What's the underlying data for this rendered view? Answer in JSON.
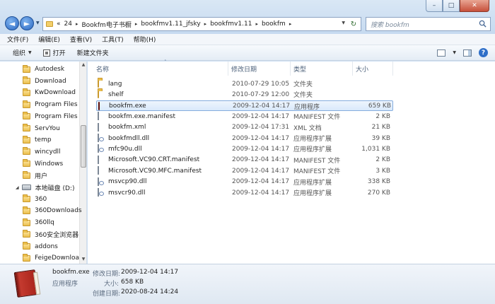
{
  "window": {
    "controls": {
      "minimize": "–",
      "maximize": "□",
      "close": "✕"
    }
  },
  "nav": {
    "back": "◄",
    "forward": "►",
    "dropdown": "▼"
  },
  "address": {
    "overflow": "«",
    "crumbs": [
      "24",
      "Bookfm电子书橱",
      "bookfmv1.11_jfsky",
      "bookfmv1.11",
      "bookfm"
    ],
    "sep": "▸",
    "refresh": "↻"
  },
  "search": {
    "placeholder": "搜索 bookfm"
  },
  "menu": [
    "文件(F)",
    "编辑(E)",
    "查看(V)",
    "工具(T)",
    "帮助(H)"
  ],
  "toolbar": {
    "organize": "组织",
    "open": "打开",
    "new_folder": "新建文件夹",
    "caret": "▼",
    "help": "?"
  },
  "navpane": {
    "items": [
      {
        "label": "Autodesk",
        "kind": "folder"
      },
      {
        "label": "Download",
        "kind": "folder"
      },
      {
        "label": "KwDownload",
        "kind": "folder"
      },
      {
        "label": "Program Files",
        "kind": "folder"
      },
      {
        "label": "Program Files",
        "kind": "folder"
      },
      {
        "label": "ServYou",
        "kind": "folder"
      },
      {
        "label": "temp",
        "kind": "folder"
      },
      {
        "label": "wincydll",
        "kind": "folder"
      },
      {
        "label": "Windows",
        "kind": "folder"
      },
      {
        "label": "用户",
        "kind": "folder"
      },
      {
        "label": "本地磁盘 (D:)",
        "kind": "drive"
      },
      {
        "label": "360",
        "kind": "folder"
      },
      {
        "label": "360Downloads",
        "kind": "folder"
      },
      {
        "label": "360llq",
        "kind": "folder"
      },
      {
        "label": "360安全浏览器",
        "kind": "folder"
      },
      {
        "label": "addons",
        "kind": "folder"
      },
      {
        "label": "FeigeDownloa",
        "kind": "folder"
      }
    ],
    "scroll_up": "▲",
    "scroll_down": "▼"
  },
  "columns": {
    "name": "名称",
    "date": "修改日期",
    "type": "类型",
    "size": "大小",
    "sort": "˄"
  },
  "files": [
    {
      "name": "lang",
      "date": "2010-07-29 10:05",
      "type": "文件夹",
      "size": "",
      "icon": "folder"
    },
    {
      "name": "shelf",
      "date": "2010-07-29 12:00",
      "type": "文件夹",
      "size": "",
      "icon": "folder"
    },
    {
      "name": "bookfm.exe",
      "date": "2009-12-04 14:17",
      "type": "应用程序",
      "size": "659 KB",
      "icon": "exe"
    },
    {
      "name": "bookfm.exe.manifest",
      "date": "2009-12-04 14:17",
      "type": "MANIFEST 文件",
      "size": "2 KB",
      "icon": "doc"
    },
    {
      "name": "bookfm.xml",
      "date": "2009-12-04 17:31",
      "type": "XML 文档",
      "size": "21 KB",
      "icon": "doc"
    },
    {
      "name": "bookfmdll.dll",
      "date": "2009-12-04 14:17",
      "type": "应用程序扩展",
      "size": "39 KB",
      "icon": "dll"
    },
    {
      "name": "mfc90u.dll",
      "date": "2009-12-04 14:17",
      "type": "应用程序扩展",
      "size": "1,031 KB",
      "icon": "dll"
    },
    {
      "name": "Microsoft.VC90.CRT.manifest",
      "date": "2009-12-04 14:17",
      "type": "MANIFEST 文件",
      "size": "2 KB",
      "icon": "doc"
    },
    {
      "name": "Microsoft.VC90.MFC.manifest",
      "date": "2009-12-04 14:17",
      "type": "MANIFEST 文件",
      "size": "3 KB",
      "icon": "doc"
    },
    {
      "name": "msvcp90.dll",
      "date": "2009-12-04 14:17",
      "type": "应用程序扩展",
      "size": "338 KB",
      "icon": "dll"
    },
    {
      "name": "msvcr90.dll",
      "date": "2009-12-04 14:17",
      "type": "应用程序扩展",
      "size": "270 KB",
      "icon": "dll"
    }
  ],
  "selected_index": 2,
  "details": {
    "name": "bookfm.exe",
    "modified_label": "修改日期:",
    "modified": "2009-12-04 14:17",
    "type": "应用程序",
    "size_label": "大小:",
    "size": "658 KB",
    "created_label": "创建日期:",
    "created": "2020-08-24 14:24"
  }
}
